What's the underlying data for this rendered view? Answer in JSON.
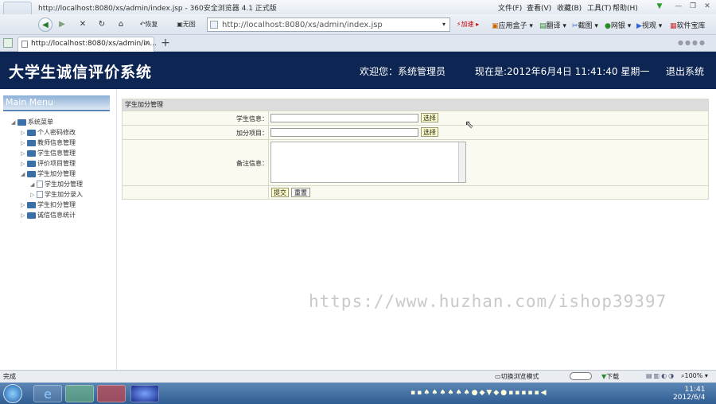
{
  "browser": {
    "title": "http://localhost:8080/xs/admin/index.jsp - 360安全浏览器 4.1 正式版",
    "menu": [
      "文件(F)",
      "查看(V)",
      "收藏(B)",
      "工具(T)",
      "帮助(H)"
    ],
    "nav": {
      "restore_label": "恢复",
      "noimage_label": "无图"
    },
    "url": "http://localhost:8080/xs/admin/index.jsp",
    "accelerate_label": "加速",
    "tools": [
      "应用盒子",
      "翻译",
      "截图",
      "网银",
      "视观",
      "软件宝库"
    ],
    "tab_title": "http://localhost:8080/xs/admin/in..."
  },
  "header": {
    "app_title": "大学生诚信评价系统",
    "welcome": "欢迎您：系统管理员",
    "now_label": "现在是:2012年6月4日  11:41:40 星期一",
    "logout": "退出系统"
  },
  "sidebar": {
    "heading": "Main Menu",
    "root": "系统菜单",
    "items": [
      {
        "label": "个人密码修改",
        "type": "folder",
        "expanded": false
      },
      {
        "label": "教师信息管理",
        "type": "folder",
        "expanded": false
      },
      {
        "label": "学生信息管理",
        "type": "folder",
        "expanded": false
      },
      {
        "label": "评价项目管理",
        "type": "folder",
        "expanded": false
      },
      {
        "label": "学生加分管理",
        "type": "folder",
        "expanded": true
      },
      {
        "label": "学生加分管理",
        "type": "page",
        "level": 2
      },
      {
        "label": "学生加分录入",
        "type": "page",
        "level": 2
      },
      {
        "label": "学生扣分管理",
        "type": "folder",
        "expanded": false
      },
      {
        "label": "诚信信息统计",
        "type": "folder",
        "expanded": false
      }
    ]
  },
  "form": {
    "panel_title": "学生加分管理",
    "student_label": "学生信息：",
    "item_label": "加分项目：",
    "remark_label": "备注信息：",
    "choose_label": "选择",
    "submit_label": "提交",
    "reset_label": "重置"
  },
  "watermark": "https://www.huzhan.com/ishop39397",
  "status": {
    "left": "完成",
    "mode": "切换浏览模式",
    "download": "下载",
    "zoom": "100%"
  },
  "taskbar": {
    "time": "11:41",
    "date": "2012/6/4"
  },
  "colors": {
    "header_bg": "#0d2552",
    "menu_head": "#8cb0d6",
    "panel_bg": "#fbfaf0",
    "button_bg": "#ffffc8"
  }
}
